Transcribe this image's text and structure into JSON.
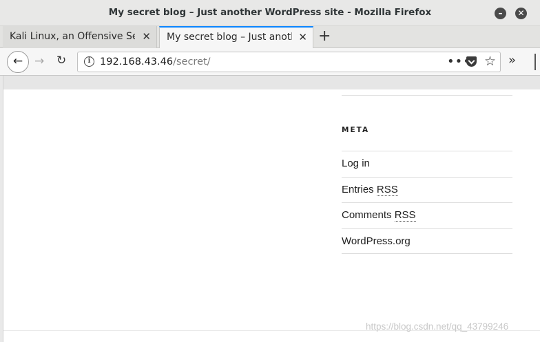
{
  "window": {
    "title": "My secret blog – Just another WordPress site - Mozilla Firefox",
    "minimize_glyph": "–",
    "close_glyph": "✕"
  },
  "tabs": [
    {
      "label": "Kali Linux, an Offensive Secu",
      "close": "✕",
      "active": false
    },
    {
      "label": "My secret blog – Just anothe",
      "close": "✕",
      "active": true
    }
  ],
  "new_tab": "+",
  "nav": {
    "back": "←",
    "forward": "→",
    "reload": "↻",
    "url_host": "192.168.43.46",
    "url_path": "/secret/",
    "info_icon": "i",
    "page_actions": "•••",
    "bookmark": "☆",
    "overflow": "»"
  },
  "sidebar": {
    "widget_title": "META",
    "links": [
      {
        "text": "Log in"
      },
      {
        "pre": "Entries ",
        "abbr": "RSS"
      },
      {
        "pre": "Comments ",
        "abbr": "RSS"
      },
      {
        "text": "WordPress.org"
      }
    ]
  },
  "watermark": "https://blog.csdn.net/qq_43799246"
}
